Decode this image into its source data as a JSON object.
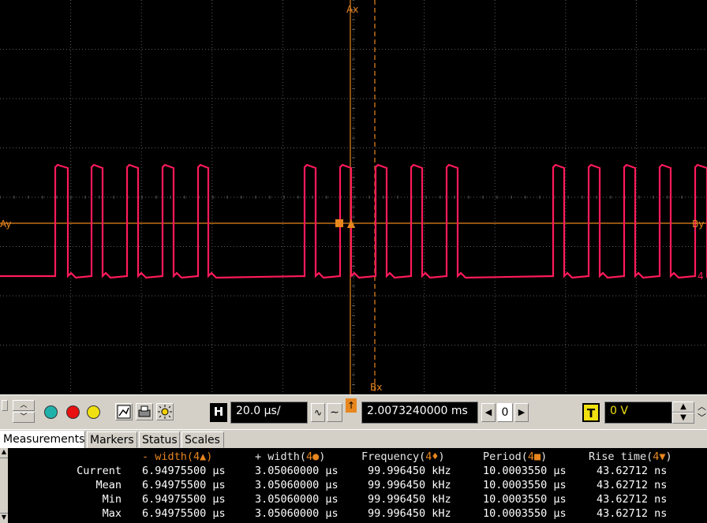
{
  "markers": {
    "ax": "Ax",
    "bx": "Bx",
    "ay": "Ay",
    "by": "By",
    "channel": "4"
  },
  "colors": {
    "grid": "#5a5a5a",
    "signal": "#ff1a5a",
    "marker": "#e8861e",
    "toolbar": "#d4d0c8"
  },
  "toolbar": {
    "h_label": "H",
    "h_value": "20.0 µs/",
    "delay_value": "2.0073240000 ms",
    "step_value": "0",
    "t_label": "T",
    "trigger_value": "0 V"
  },
  "tabs": [
    {
      "label": "Measurements",
      "active": true
    },
    {
      "label": "Markers",
      "active": false
    },
    {
      "label": "Status",
      "active": false
    },
    {
      "label": "Scales",
      "active": false
    }
  ],
  "measurements": {
    "headers": [
      {
        "pre": "- width(",
        "ch": "4▲",
        "post": ")"
      },
      {
        "pre": "+ width(",
        "ch": "4●",
        "post": ")"
      },
      {
        "pre": "Frequency(",
        "ch": "4♦",
        "post": ")"
      },
      {
        "pre": "Period(",
        "ch": "4■",
        "post": ")"
      },
      {
        "pre": "Rise time(",
        "ch": "4▼",
        "post": ")"
      }
    ],
    "rows": [
      {
        "label": "Current",
        "values": [
          "6.94975500 µs",
          "3.05060000 µs",
          "99.996450 kHz",
          "10.0003550 µs",
          "43.62712 ns"
        ]
      },
      {
        "label": "Mean",
        "values": [
          "6.94975500 µs",
          "3.05060000 µs",
          "99.996450 kHz",
          "10.0003550 µs",
          "43.62712 ns"
        ]
      },
      {
        "label": "Min",
        "values": [
          "6.94975500 µs",
          "3.05060000 µs",
          "99.996450 kHz",
          "10.0003550 µs",
          "43.62712 ns"
        ]
      },
      {
        "label": "Max",
        "values": [
          "6.94975500 µs",
          "3.05060000 µs",
          "99.996450 kHz",
          "10.0003550 µs",
          "43.62712 ns"
        ]
      }
    ]
  }
}
